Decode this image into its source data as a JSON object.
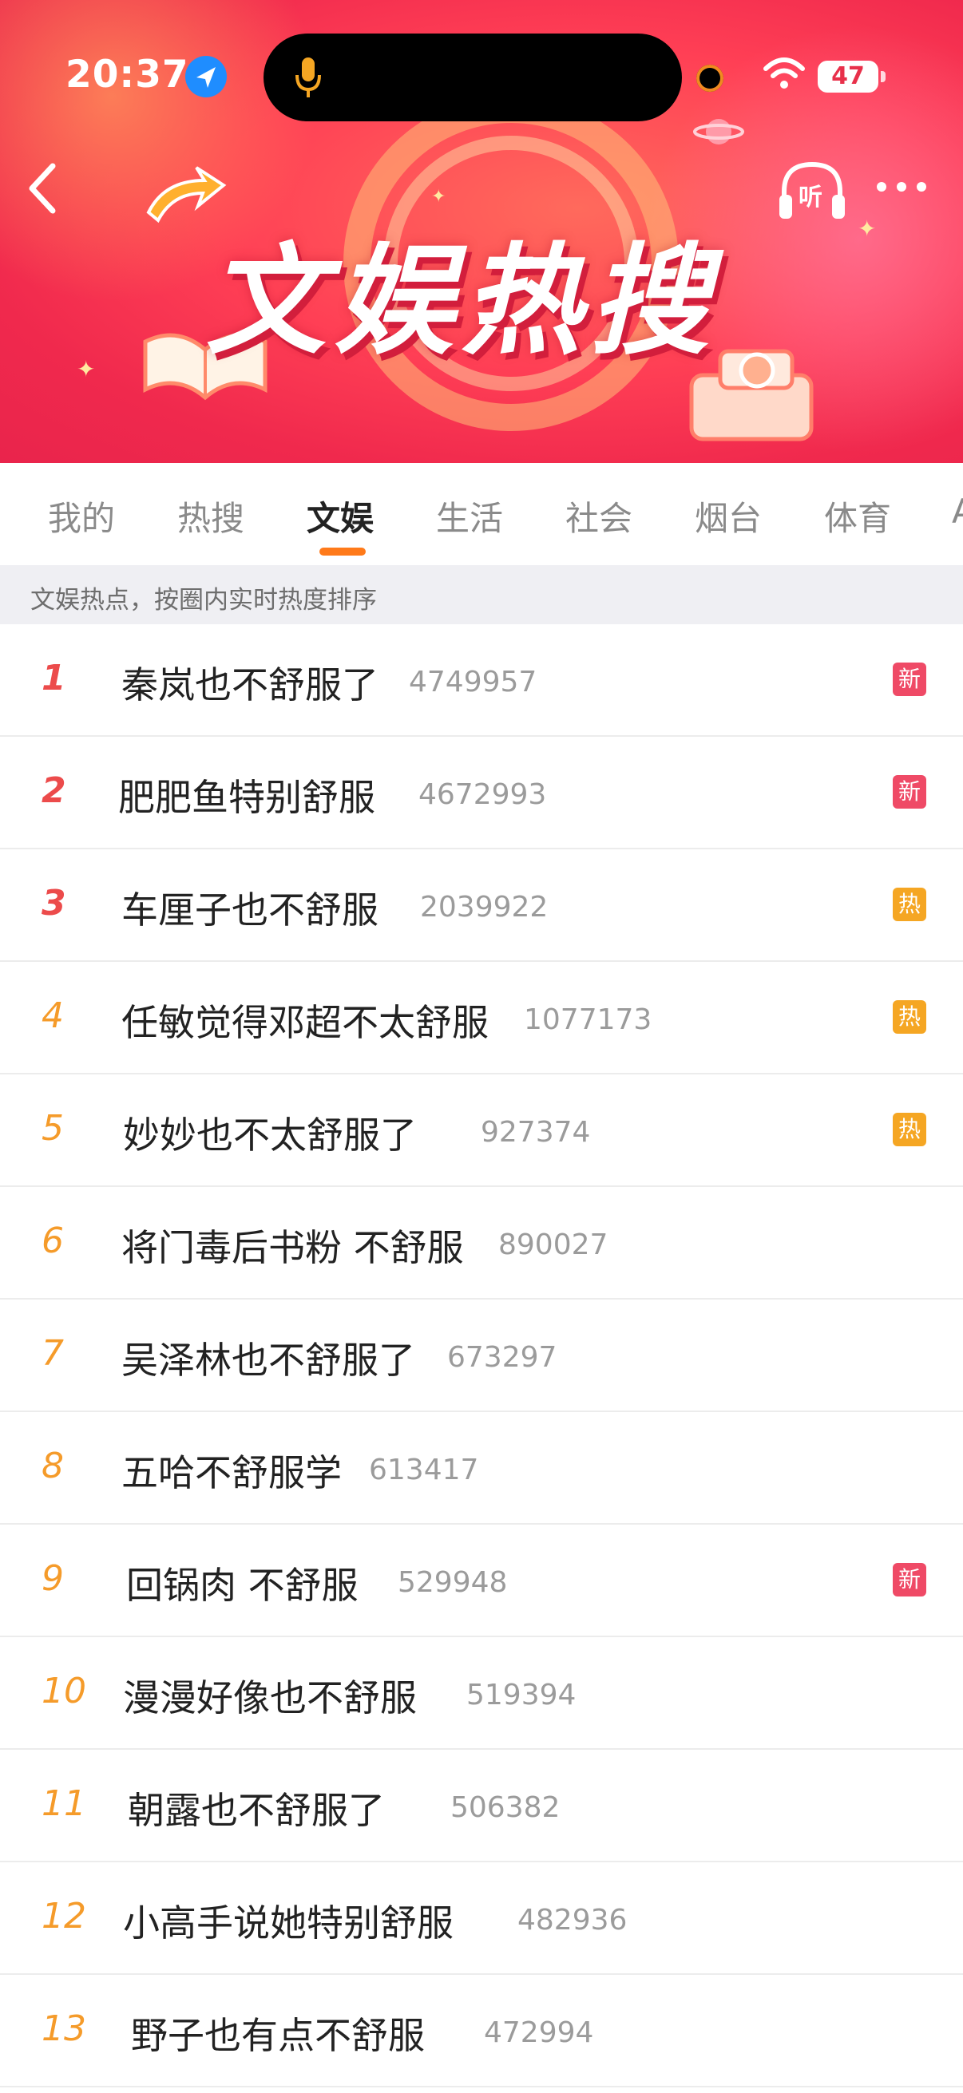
{
  "status_bar": {
    "time": "20:37",
    "battery": "47"
  },
  "header": {
    "title": "文娱热搜",
    "listen_label": "听"
  },
  "tabs": [
    {
      "label": "我的",
      "active": false
    },
    {
      "label": "热搜",
      "active": false
    },
    {
      "label": "文娱",
      "active": true
    },
    {
      "label": "生活",
      "active": false
    },
    {
      "label": "社会",
      "active": false
    },
    {
      "label": "烟台",
      "active": false
    },
    {
      "label": "体育",
      "active": false
    },
    {
      "label": "A",
      "active": false
    }
  ],
  "subheader": "文娱热点，按圈内实时热度排序",
  "colors": {
    "accent": "#ff7a1a",
    "rank_top": "#ec4b4b",
    "rank_other": "#f59b2a",
    "badge_new": "#ef4a66",
    "badge_hot": "#f5a623"
  },
  "items": [
    {
      "rank": "1",
      "title": "秦岚也不舒服了",
      "heat": "4749957",
      "badge": "新"
    },
    {
      "rank": "2",
      "title": "肥肥鱼特别舒服",
      "heat": "4672993",
      "badge": "新"
    },
    {
      "rank": "3",
      "title": "车厘子也不舒服",
      "heat": "2039922",
      "badge": "热"
    },
    {
      "rank": "4",
      "title": "任敏觉得邓超不太舒服",
      "heat": "1077173",
      "badge": "热"
    },
    {
      "rank": "5",
      "title": "妙妙也不太舒服了",
      "heat": "927374",
      "badge": "热"
    },
    {
      "rank": "6",
      "title": "将门毒后书粉 不舒服",
      "heat": "890027",
      "badge": ""
    },
    {
      "rank": "7",
      "title": "吴泽林也不舒服了",
      "heat": "673297",
      "badge": ""
    },
    {
      "rank": "8",
      "title": "五哈不舒服学",
      "heat": "613417",
      "badge": ""
    },
    {
      "rank": "9",
      "title": "回锅肉 不舒服",
      "heat": "529948",
      "badge": "新"
    },
    {
      "rank": "10",
      "title": "漫漫好像也不舒服",
      "heat": "519394",
      "badge": ""
    },
    {
      "rank": "11",
      "title": "朝露也不舒服了",
      "heat": "506382",
      "badge": ""
    },
    {
      "rank": "12",
      "title": "小高手说她特别舒服",
      "heat": "482936",
      "badge": ""
    },
    {
      "rank": "13",
      "title": "野子也有点不舒服",
      "heat": "472994",
      "badge": ""
    }
  ]
}
